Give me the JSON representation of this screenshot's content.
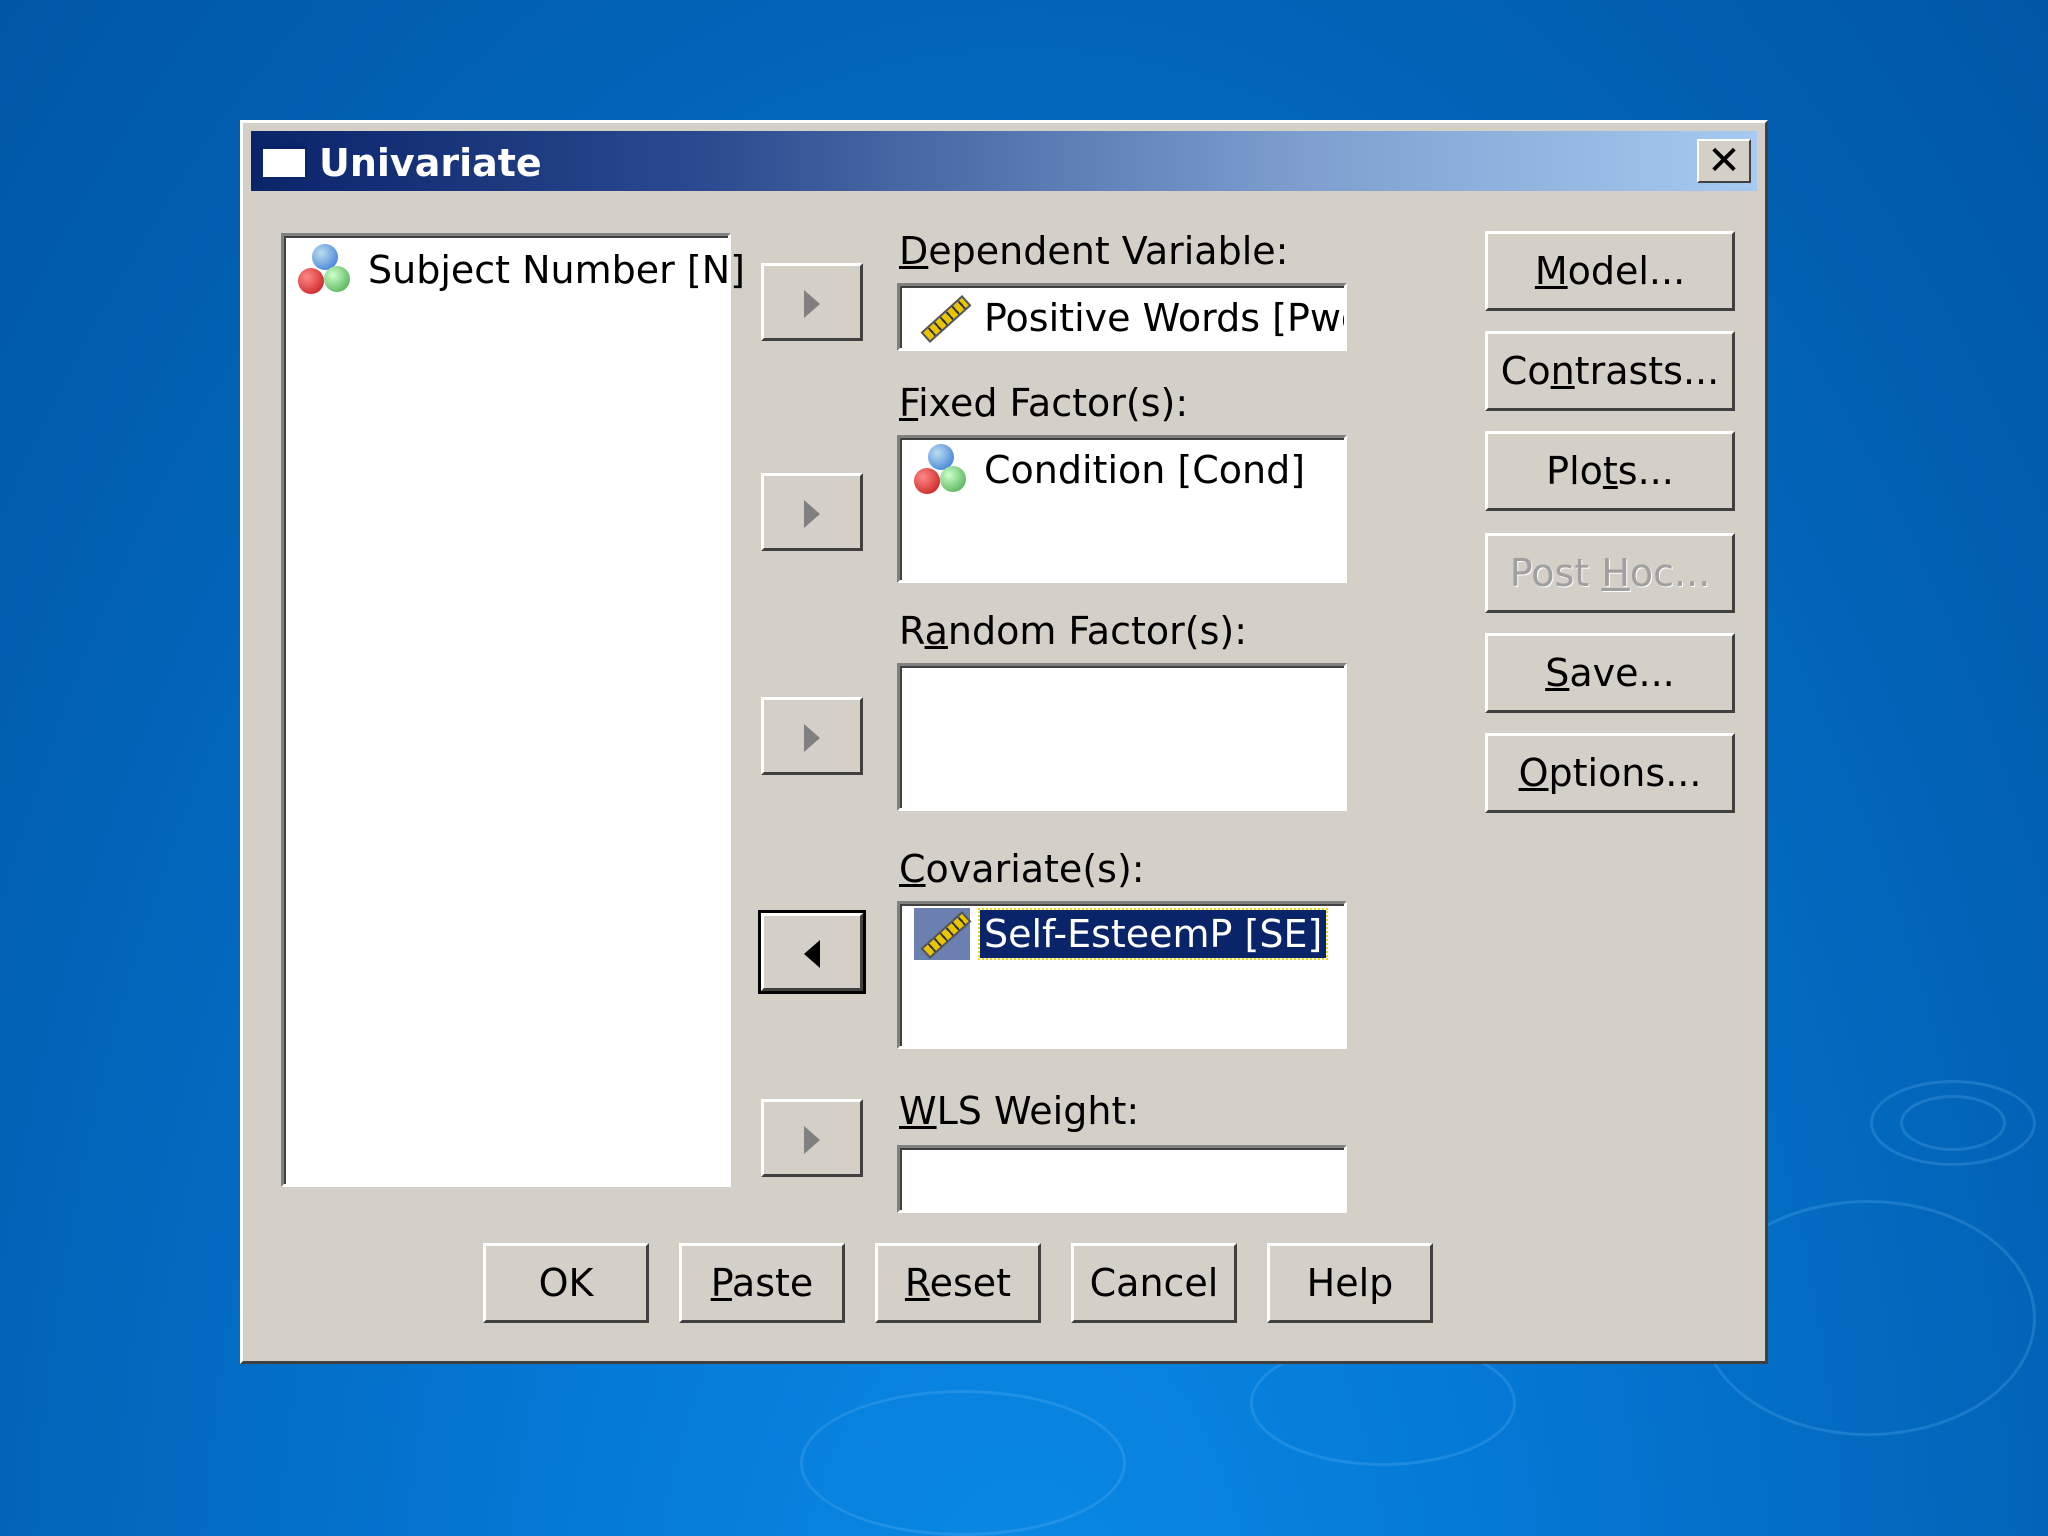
{
  "dialog": {
    "title": "Univariate",
    "close_label": "✕"
  },
  "source_list": {
    "items": [
      {
        "label": "Subject Number [N]",
        "icon": "nominal-variable-icon"
      }
    ]
  },
  "fields": {
    "dependent": {
      "label_key": "D",
      "label_rest": "ependent Variable:",
      "value": "Positive Words [Pwords]",
      "icon": "scale-variable-icon"
    },
    "fixed": {
      "label_key": "F",
      "label_rest": "ixed Factor(s):",
      "items": [
        {
          "label": "Condition [Cond]",
          "icon": "nominal-variable-icon"
        }
      ]
    },
    "random": {
      "label_pre": "R",
      "label_key": "a",
      "label_rest": "ndom Factor(s):",
      "items": []
    },
    "covariate": {
      "label_key": "C",
      "label_rest": "ovariate(s):",
      "items": [
        {
          "label": "Self-EsteemP [SE]",
          "icon": "scale-variable-icon",
          "selected": true
        }
      ]
    },
    "wls": {
      "label_key": "W",
      "label_rest": "LS Weight:",
      "value": ""
    }
  },
  "side_buttons": {
    "model": {
      "key": "M",
      "rest": "odel..."
    },
    "contrasts": {
      "pre": "Co",
      "key": "n",
      "rest": "trasts..."
    },
    "plots": {
      "pre": "Plo",
      "key": "t",
      "rest": "s..."
    },
    "posthoc": {
      "pre": "Post ",
      "key": "H",
      "rest": "oc...",
      "disabled": true
    },
    "save": {
      "key": "S",
      "rest": "ave..."
    },
    "options": {
      "key": "O",
      "rest": "ptions..."
    }
  },
  "bottom_buttons": {
    "ok": {
      "pre": "OK",
      "key": "",
      "rest": ""
    },
    "paste": {
      "key": "P",
      "rest": "aste"
    },
    "reset": {
      "key": "R",
      "rest": "eset"
    },
    "cancel": {
      "pre": "Cancel",
      "key": "",
      "rest": ""
    },
    "help": {
      "pre": "Help",
      "key": "",
      "rest": ""
    }
  },
  "colors": {
    "dialog_face": "#d4d0c8",
    "title_start": "#0a246a",
    "title_end": "#a6caf0",
    "selection": "#0a246a",
    "desktop": "#0478d4"
  }
}
